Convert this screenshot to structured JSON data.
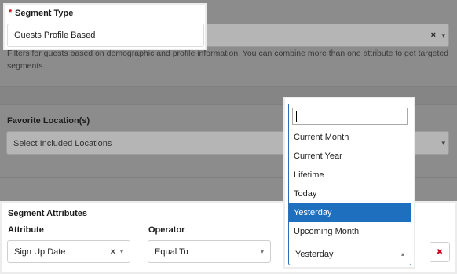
{
  "segment_type": {
    "required_mark": "*",
    "label": "Segment Type",
    "value": "Guests Profile Based",
    "clear_glyph": "×",
    "chevron_glyph": "▾",
    "help_line1": "Filters for guests based on demographic and profile information. You can combine more than one attribute to get targeted",
    "help_line2": "segments."
  },
  "favorite_locations": {
    "label": "Favorite Location(s)",
    "placeholder": "Select Included Locations",
    "chevron_glyph": "▾"
  },
  "segment_attributes": {
    "title": "Segment Attributes",
    "attribute_label": "Attribute",
    "operator_label": "Operator",
    "attribute_value": "Sign Up Date",
    "attribute_clear": "×",
    "operator_value": "Equal To",
    "period_value": "Yesterday",
    "chevron_glyph": "▾",
    "up_glyph": "▴",
    "remove_glyph": "✖",
    "remove_color": "#d0021b"
  },
  "period_dropdown": {
    "search_value": "",
    "options": [
      "Current Month",
      "Current Year",
      "Lifetime",
      "Today",
      "Yesterday",
      "Upcoming Month"
    ],
    "selected": "Yesterday",
    "highlight_color": "#1f6fbf"
  }
}
